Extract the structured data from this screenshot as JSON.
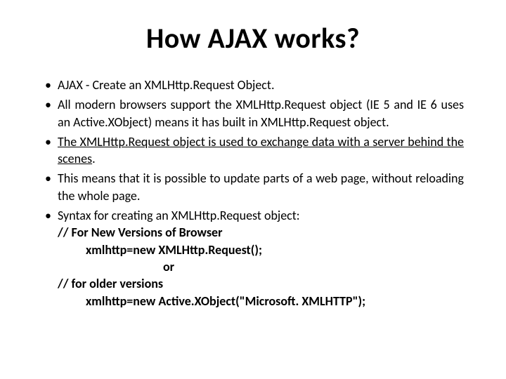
{
  "title": "How AJAX works?",
  "bullets": {
    "b1": "AJAX - Create an XMLHttp.Request Object.",
    "b2": "All modern browsers support the XMLHttp.Request object (IE 5 and IE 6 uses an Active.XObject) means it has built in XMLHttp.Request object.",
    "b3": "The XMLHttp.Request object is used to exchange data with a server behind the scenes",
    "b3_suffix": ".",
    "b4": "This means that it is possible to update parts of a web page, without reloading the whole page.",
    "b5": "Syntax for creating an XMLHttp.Request object:",
    "b5_l1": "// For New Versions of Browser",
    "b5_l2": "xmlhttp=new XMLHttp.Request();",
    "b5_l3": "or",
    "b5_l4": "// for older versions",
    "b5_l5": "xmlhttp=new Active.XObject(\"Microsoft. XMLHTTP\");"
  }
}
